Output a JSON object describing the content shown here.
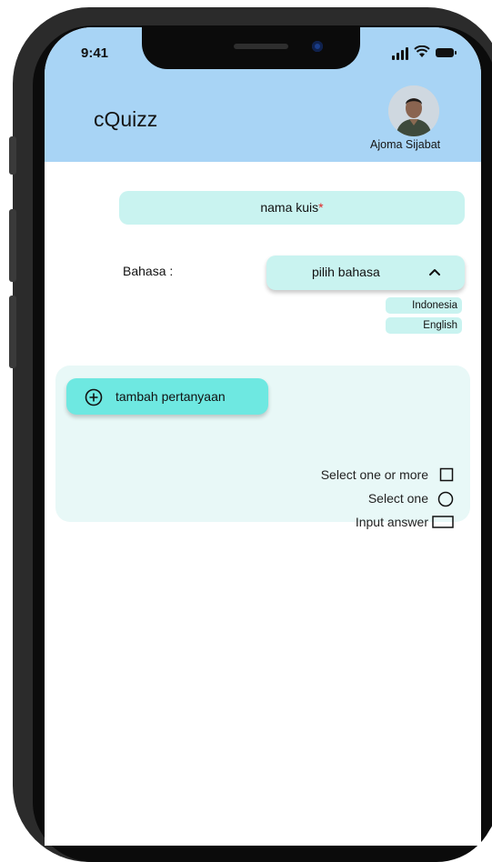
{
  "status_bar": {
    "time": "9:41"
  },
  "header": {
    "app_title": "cQuizz",
    "user_name": "Ajoma Sijabat"
  },
  "quiz_name": {
    "placeholder": "nama kuis",
    "required_mark": "*"
  },
  "language": {
    "label": "Bahasa :",
    "selected": "pilih bahasa",
    "options": [
      "Indonesia",
      "English"
    ]
  },
  "questions": {
    "add_label": "tambah pertanyaan",
    "answer_types": [
      "Select one or more",
      "Select one",
      "Input answer"
    ]
  },
  "colors": {
    "header_bg": "#a8d4f5",
    "field_bg": "#c9f3f0",
    "accent_button": "#6ee8e1",
    "panel_bg": "#e8f8f7",
    "required": "#e02727"
  }
}
